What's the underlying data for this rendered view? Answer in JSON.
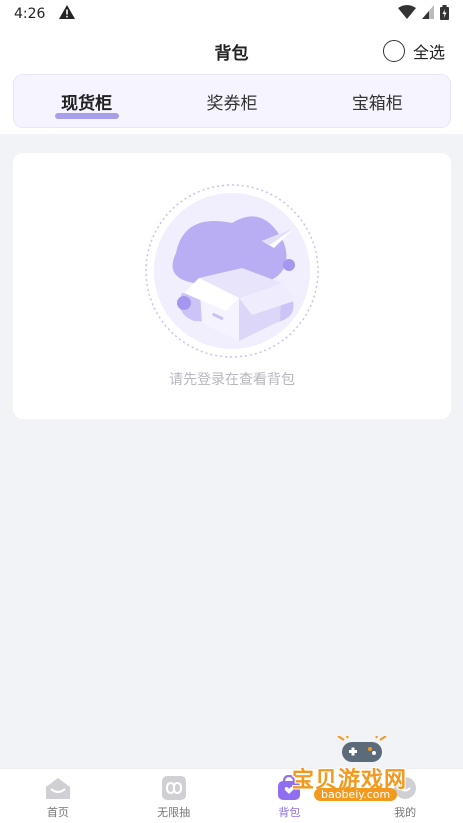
{
  "status_bar": {
    "time": "4:26",
    "warning_icon": "warning-triangle-icon"
  },
  "header": {
    "title": "背包",
    "select_all_label": "全选"
  },
  "tabs": [
    {
      "label": "现货柜",
      "active": true
    },
    {
      "label": "奖券柜",
      "active": false
    },
    {
      "label": "宝箱柜",
      "active": false
    }
  ],
  "empty_state": {
    "message": "请先登录在查看背包",
    "icon": "empty-box-icon"
  },
  "bottom_nav": [
    {
      "label": "首页",
      "icon": "home-icon",
      "active": false
    },
    {
      "label": "无限抽",
      "icon": "infinity-icon",
      "active": false
    },
    {
      "label": "背包",
      "icon": "bag-icon",
      "active": true
    },
    {
      "label": "我的",
      "icon": "profile-icon",
      "active": false
    }
  ],
  "watermark": {
    "text": "宝贝游戏网",
    "url": "baobeiy.com"
  },
  "colors": {
    "accent": "#8f6ff0",
    "background": "#f2f3f7",
    "tab_bg": "#f6f5ff"
  }
}
